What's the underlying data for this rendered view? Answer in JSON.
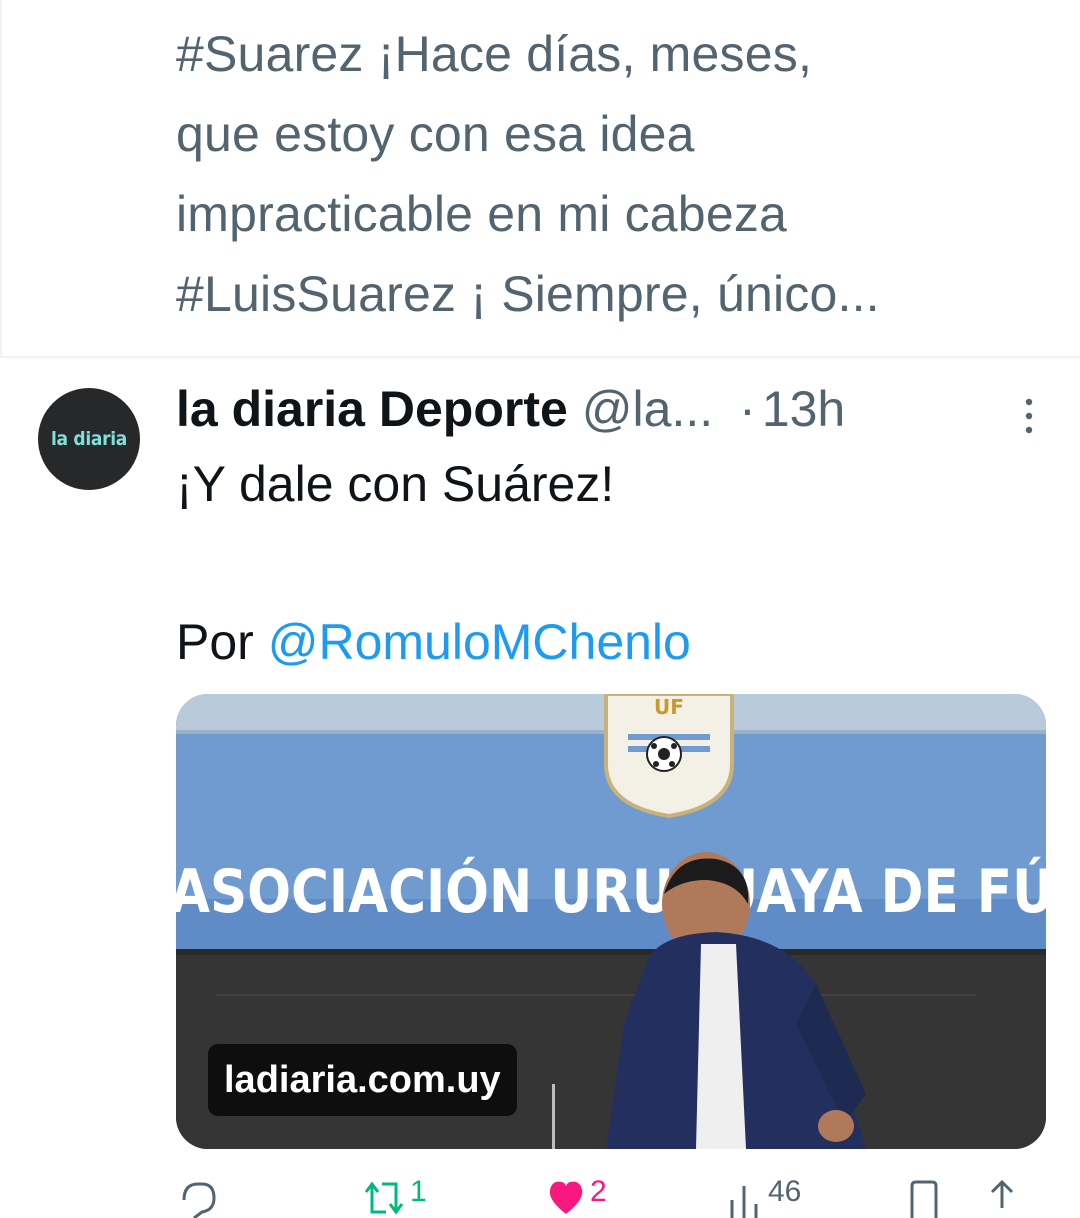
{
  "previous_tweet": {
    "text": "#Suarez ¡Hace días, meses,\nque estoy con esa idea\nimpracticable en mi cabeza\n#LuisSuarez ¡ Siempre, único..."
  },
  "tweet": {
    "avatar_text": "la diaria",
    "display_name": "la diaria Deporte",
    "handle": "@la...",
    "separator": "·",
    "time": "13h",
    "body_line1": "¡Y dale con Suárez!",
    "body_prefix": "Por ",
    "mention": "@RomuloMChenlo",
    "card": {
      "banner_text": "ASOCIACIÓN URUGUAYA DE FÚ",
      "crest_text": "UF",
      "domain": "ladiaria.com.uy"
    },
    "actions": {
      "reply_icon": "reply-icon",
      "retweet_icon": "retweet-icon",
      "retweet_count": "1",
      "like_icon": "heart-icon",
      "like_count": "2",
      "views_icon": "views-icon",
      "views_count": "46",
      "bookmark_icon": "bookmark-icon",
      "share_icon": "share-icon"
    }
  },
  "colors": {
    "text_primary": "#0f1419",
    "text_secondary": "#536471",
    "link": "#1d9bf0",
    "retweet": "#00ba7c",
    "like": "#f91880",
    "avatar_bg": "#26282a",
    "avatar_text": "#7fe0da"
  }
}
